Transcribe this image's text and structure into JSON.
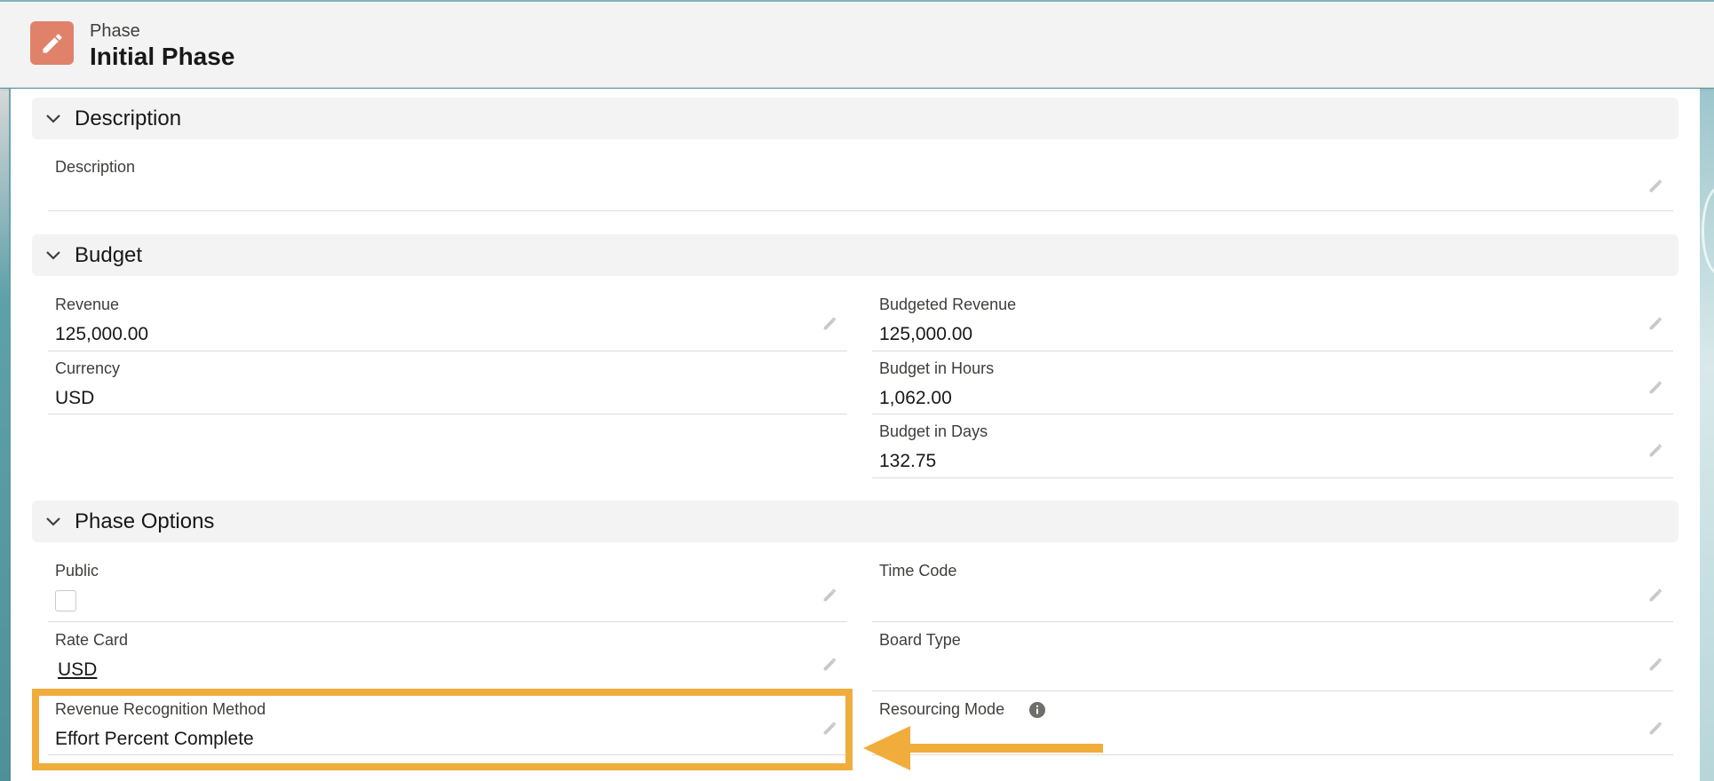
{
  "header": {
    "object_type": "Phase",
    "record_name": "Initial Phase",
    "icon": "pencil-icon",
    "icon_color": "#e0826a"
  },
  "sections": {
    "description": {
      "title": "Description",
      "fields": {
        "description": {
          "label": "Description",
          "value": ""
        }
      }
    },
    "budget": {
      "title": "Budget",
      "fields": {
        "revenue": {
          "label": "Revenue",
          "value": "125,000.00"
        },
        "budgeted_revenue": {
          "label": "Budgeted Revenue",
          "value": "125,000.00"
        },
        "currency": {
          "label": "Currency",
          "value": "USD"
        },
        "budget_hours": {
          "label": "Budget in Hours",
          "value": "1,062.00"
        },
        "budget_days": {
          "label": "Budget in Days",
          "value": "132.75"
        }
      }
    },
    "phase_options": {
      "title": "Phase Options",
      "fields": {
        "public": {
          "label": "Public",
          "checked": false
        },
        "time_code": {
          "label": "Time Code",
          "value": ""
        },
        "rate_card": {
          "label": "Rate Card",
          "value": "USD"
        },
        "board_type": {
          "label": "Board Type",
          "value": ""
        },
        "revenue_recognition_method": {
          "label": "Revenue Recognition Method",
          "value": "Effort Percent Complete"
        },
        "resourcing_mode": {
          "label": "Resourcing Mode",
          "value": "",
          "info_icon": "info-icon"
        }
      }
    }
  },
  "annotation": {
    "highlight_color": "#f0ad3c",
    "arrow": "left-arrow"
  }
}
